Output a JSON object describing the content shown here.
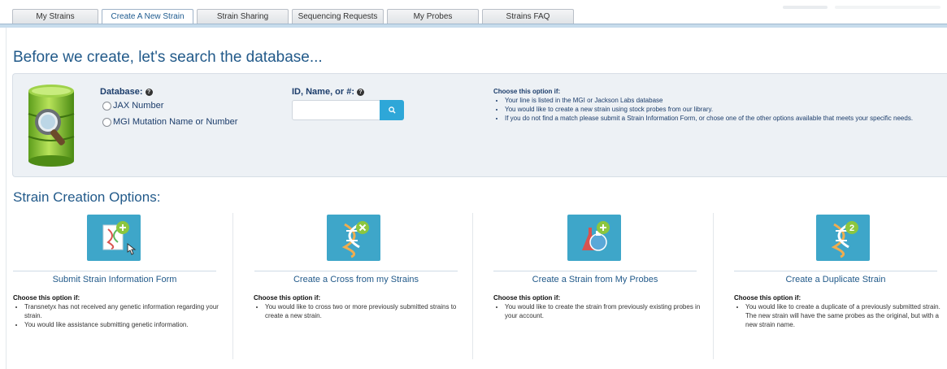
{
  "tabs": [
    {
      "label": "My Strains",
      "active": false
    },
    {
      "label": "Create A New Strain",
      "active": true
    },
    {
      "label": "Strain Sharing",
      "active": false
    },
    {
      "label": "Sequencing Requests",
      "active": false
    },
    {
      "label": "My Probes",
      "active": false
    },
    {
      "label": "Strains FAQ",
      "active": false
    }
  ],
  "search": {
    "heading": "Before we create, let's search the database...",
    "database_label": "Database:",
    "options": [
      "JAX Number",
      "MGI Mutation Name or Number"
    ],
    "id_label": "ID, Name, or #:",
    "input_value": "",
    "icons": {
      "database": "database-search-icon",
      "search": "search-icon",
      "help": "help-icon"
    },
    "choose_title": "Choose this option if:",
    "bullets": [
      "Your line is listed in the MGI or Jackson Labs database",
      "You would like to create a new strain using stock probes from our library.",
      "If you do not find a match please submit a Strain Information Form, or chose one of the other options available that meets your specific needs."
    ]
  },
  "options_heading": "Strain Creation Options:",
  "options": [
    {
      "title": "Submit Strain Information Form",
      "icon": "strain-form-add-icon",
      "choose": "Choose this option if:",
      "bullets": [
        "Transnetyx has not received any genetic information regarding your strain.",
        "You would like assistance submitting genetic information."
      ]
    },
    {
      "title": "Create a Cross from my Strains",
      "icon": "strain-cross-icon",
      "choose": "Choose this option if:",
      "bullets": [
        "You would like to cross two or more previously submitted strains to create a new strain."
      ]
    },
    {
      "title": "Create a Strain from My Probes",
      "icon": "probe-flask-add-icon",
      "choose": "Choose this option if:",
      "bullets": [
        "You would like to create the strain from previously existing probes in your account."
      ]
    },
    {
      "title": "Create a Duplicate Strain",
      "icon": "strain-duplicate-icon",
      "choose": "Choose this option if:",
      "bullets": [
        "You would like to create a duplicate of a previously submitted strain. The new strain will have the same probes as the original, but with a new strain name."
      ]
    }
  ],
  "colors": {
    "accent": "#225a8a",
    "button": "#3ea6c9",
    "search_button": "#2ea7d8",
    "panel": "#edf1f5"
  }
}
